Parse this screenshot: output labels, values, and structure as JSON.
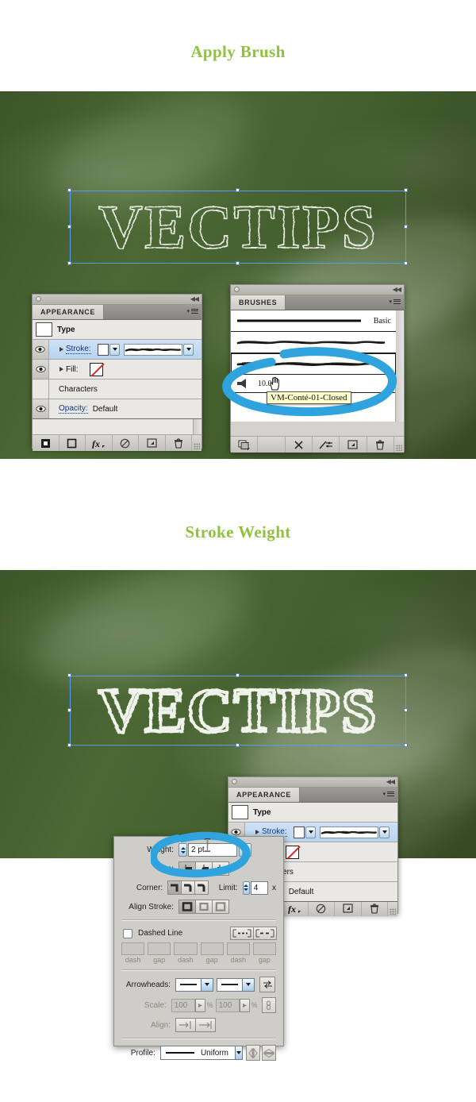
{
  "page": {
    "background": "#ffffff",
    "accent_green": "#8fc33e",
    "chalkboard_green": "#44602e",
    "annotation_blue": "#2ea3dd",
    "selection_blue": "#5b9bf5"
  },
  "sections": [
    {
      "heading": "Apply Brush"
    },
    {
      "heading": "Stroke Weight"
    }
  ],
  "artwork": {
    "text": "VECTIPS"
  },
  "appearance_panel": {
    "tab": "APPEARANCE",
    "rows": [
      {
        "label": "Type",
        "icon": "type-swatch"
      },
      {
        "label": "Stroke:",
        "icon": "eye-icon"
      },
      {
        "label": "Fill:",
        "icon": "eye-icon"
      },
      {
        "label": "Characters",
        "icon": "none"
      },
      {
        "label": "Opacity:",
        "value": "Default",
        "icon": "eye-icon"
      }
    ],
    "footer_icons": [
      "add-new-stroke-icon",
      "add-new-fill-icon",
      "add-new-effect-icon",
      "clear-appearance-icon",
      "duplicate-item-icon",
      "delete-item-icon"
    ]
  },
  "brushes_panel": {
    "tab": "BRUSHES",
    "items": [
      {
        "name": "Basic",
        "type": "basic-stroke"
      },
      {
        "name": "",
        "type": "art-brush"
      },
      {
        "name": "",
        "type": "art-brush",
        "selected": true
      },
      {
        "name": "",
        "type": "scatter-brush",
        "value": "10.00"
      }
    ],
    "tooltip": "VM-Conté-01-Closed",
    "footer_icons": [
      "brush-libraries-icon",
      "remove-brush-stroke-icon",
      "brush-options-icon",
      "new-brush-icon",
      "delete-brush-icon"
    ]
  },
  "stroke_panel": {
    "weight": {
      "label": "Weight:",
      "value": "2 pt"
    },
    "cap": {
      "label": "Cap:",
      "options": [
        "butt-cap",
        "round-cap",
        "projecting-cap"
      ],
      "selected": 0
    },
    "corner": {
      "label": "Corner:",
      "options": [
        "miter-join",
        "round-join",
        "bevel-join"
      ],
      "selected": 0
    },
    "limit": {
      "label": "Limit:",
      "value": "4",
      "unit": "x"
    },
    "align_stroke": {
      "label": "Align Stroke:",
      "options": [
        "align-center",
        "align-inside",
        "align-outside"
      ],
      "selected": 0
    },
    "dashed_line": {
      "label": "Dashed Line",
      "checked": false
    },
    "dash_fields": [
      "",
      "",
      "",
      "",
      "",
      ""
    ],
    "dash_labels": [
      "dash",
      "gap",
      "dash",
      "gap",
      "dash",
      "gap"
    ],
    "arrowheads": {
      "label": "Arrowheads:",
      "start": "None",
      "end": "None"
    },
    "scale": {
      "label": "Scale:",
      "start": "100",
      "end": "100",
      "unit": "%"
    },
    "align": {
      "label": "Align:",
      "options": [
        "extend-arrow-beyond-end",
        "place-arrow-at-end"
      ]
    },
    "profile": {
      "label": "Profile:",
      "value": "Uniform"
    }
  }
}
